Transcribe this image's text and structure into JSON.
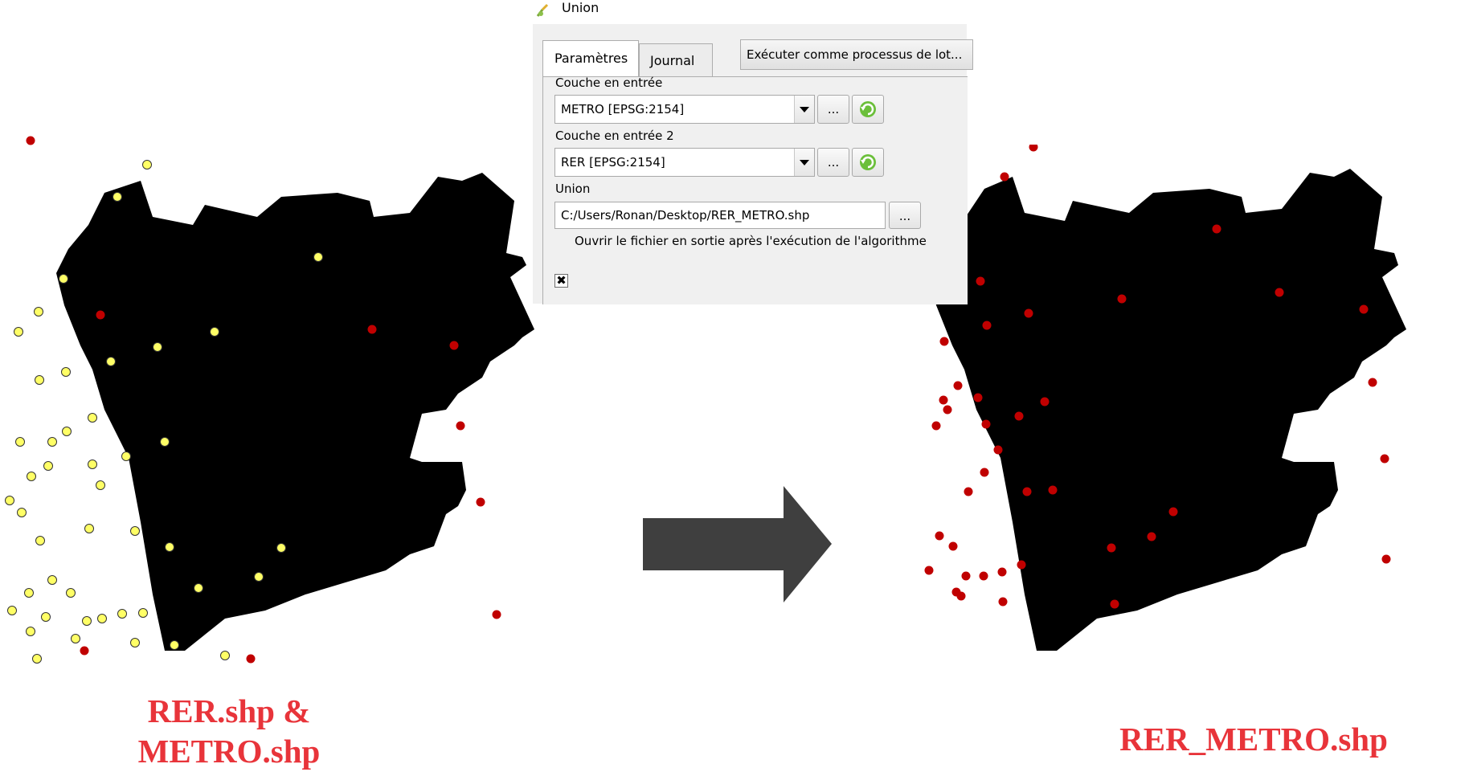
{
  "dialog": {
    "title": "Union",
    "tabs": [
      {
        "label": "Paramètres",
        "active": true
      },
      {
        "label": "Journal",
        "active": false
      }
    ],
    "batch_button_label": "Exécuter comme processus de lot...",
    "input_layer": {
      "label": "Couche en entrée",
      "value": "METRO [EPSG:2154]"
    },
    "input_layer_2": {
      "label": "Couche en entrée 2",
      "value": "RER [EPSG:2154]"
    },
    "output": {
      "label": "Union",
      "value": "C:/Users/Ronan/Desktop/RER_METRO.shp"
    },
    "browse_label": "...",
    "open_output": {
      "label": "Ouvrir le fichier en sortie après l'exécution de l'algorithme",
      "checked": true,
      "mark": "✖"
    }
  },
  "captions": {
    "left_line1": "RER.shp &",
    "left_line2": "METRO.shp",
    "right": "RER_METRO.shp"
  },
  "colors": {
    "polygon": "#000000",
    "metro_points": "#ffff66",
    "rer_points": "#c00000",
    "caption": "#e8343a",
    "arrow": "#3f3f3f"
  }
}
